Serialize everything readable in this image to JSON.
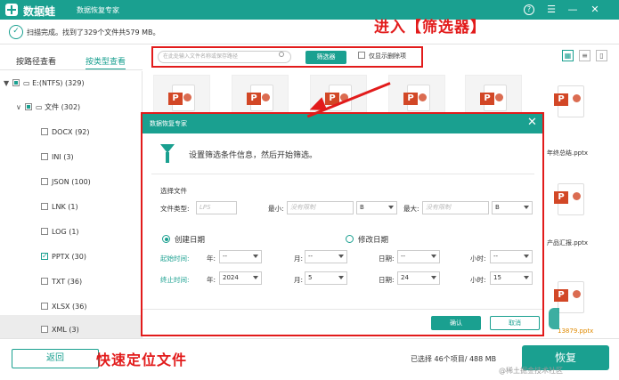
{
  "app": {
    "name": "数据蛙",
    "subtitle": "数据恢复专家",
    "help_glyph": "?",
    "menu_glyph": "☰",
    "minimize_glyph": "—",
    "close_glyph": "✕"
  },
  "annotations": {
    "top": "进入【筛选器】",
    "bottom": "快速定位文件"
  },
  "status": {
    "text": "扫描完成。找到了329个文件共579 MB。"
  },
  "left_tabs": {
    "path_view": "按路径查看",
    "type_view": "按类型查看"
  },
  "tree": {
    "drive": "E:(NTFS) (329)",
    "folder": "文件 (302)",
    "items": [
      "DOCX (92)",
      "INI (3)",
      "JSON (100)",
      "LNK (1)",
      "LOG (1)",
      "PPTX (30)",
      "TXT (36)",
      "XLSX (36)",
      "XML (3)"
    ]
  },
  "toolbar": {
    "search_placeholder": "在此处输入文件名称或保存路径",
    "filter_button": "筛选器",
    "show_deleted": "仅显示删除项"
  },
  "files": {
    "names": [
      "年终总结.pptx",
      "产品汇报.pptx",
      "13879.pptx"
    ],
    "ppt_letter": "P"
  },
  "dialog": {
    "title": "数据恢复专家",
    "description": "设置筛选条件信息，然后开始筛选。",
    "section_label": "选择文件",
    "file_type_label": "文件类型:",
    "file_type_placeholder": "LPS",
    "min_label": "最小:",
    "max_label": "最大:",
    "no_limit": "没有限制",
    "unit": "B",
    "created_date": "创建日期",
    "modified_date": "修改日期",
    "start_time": "起始时间:",
    "end_time": "终止时间:",
    "year_label": "年:",
    "month_label": "月:",
    "day_label": "日期:",
    "hour_label": "小时:",
    "empty_value": "--",
    "end_year": "2024",
    "end_month": "5",
    "end_day": "24",
    "end_hour": "15",
    "ok": "确认",
    "cancel": "取消"
  },
  "bottom": {
    "back": "返回",
    "selection_summary": "已选择 46个项目/ 488 MB",
    "recover": "恢复",
    "watermark": "@稀土掘金技术社区"
  },
  "colors": {
    "brand": "#1aa090",
    "annotation": "#e21b1b",
    "ppt": "#d24726"
  }
}
